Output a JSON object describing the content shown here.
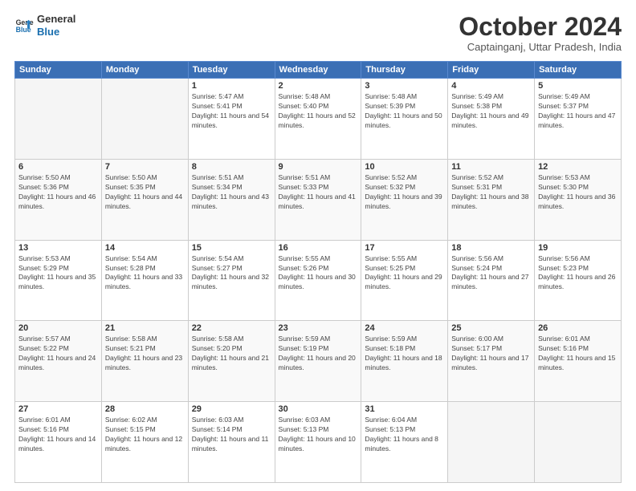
{
  "header": {
    "logo_line1": "General",
    "logo_line2": "Blue",
    "month": "October 2024",
    "location": "Captainganj, Uttar Pradesh, India"
  },
  "weekdays": [
    "Sunday",
    "Monday",
    "Tuesday",
    "Wednesday",
    "Thursday",
    "Friday",
    "Saturday"
  ],
  "weeks": [
    [
      {
        "day": "",
        "info": ""
      },
      {
        "day": "",
        "info": ""
      },
      {
        "day": "1",
        "info": "Sunrise: 5:47 AM\nSunset: 5:41 PM\nDaylight: 11 hours and 54 minutes."
      },
      {
        "day": "2",
        "info": "Sunrise: 5:48 AM\nSunset: 5:40 PM\nDaylight: 11 hours and 52 minutes."
      },
      {
        "day": "3",
        "info": "Sunrise: 5:48 AM\nSunset: 5:39 PM\nDaylight: 11 hours and 50 minutes."
      },
      {
        "day": "4",
        "info": "Sunrise: 5:49 AM\nSunset: 5:38 PM\nDaylight: 11 hours and 49 minutes."
      },
      {
        "day": "5",
        "info": "Sunrise: 5:49 AM\nSunset: 5:37 PM\nDaylight: 11 hours and 47 minutes."
      }
    ],
    [
      {
        "day": "6",
        "info": "Sunrise: 5:50 AM\nSunset: 5:36 PM\nDaylight: 11 hours and 46 minutes."
      },
      {
        "day": "7",
        "info": "Sunrise: 5:50 AM\nSunset: 5:35 PM\nDaylight: 11 hours and 44 minutes."
      },
      {
        "day": "8",
        "info": "Sunrise: 5:51 AM\nSunset: 5:34 PM\nDaylight: 11 hours and 43 minutes."
      },
      {
        "day": "9",
        "info": "Sunrise: 5:51 AM\nSunset: 5:33 PM\nDaylight: 11 hours and 41 minutes."
      },
      {
        "day": "10",
        "info": "Sunrise: 5:52 AM\nSunset: 5:32 PM\nDaylight: 11 hours and 39 minutes."
      },
      {
        "day": "11",
        "info": "Sunrise: 5:52 AM\nSunset: 5:31 PM\nDaylight: 11 hours and 38 minutes."
      },
      {
        "day": "12",
        "info": "Sunrise: 5:53 AM\nSunset: 5:30 PM\nDaylight: 11 hours and 36 minutes."
      }
    ],
    [
      {
        "day": "13",
        "info": "Sunrise: 5:53 AM\nSunset: 5:29 PM\nDaylight: 11 hours and 35 minutes."
      },
      {
        "day": "14",
        "info": "Sunrise: 5:54 AM\nSunset: 5:28 PM\nDaylight: 11 hours and 33 minutes."
      },
      {
        "day": "15",
        "info": "Sunrise: 5:54 AM\nSunset: 5:27 PM\nDaylight: 11 hours and 32 minutes."
      },
      {
        "day": "16",
        "info": "Sunrise: 5:55 AM\nSunset: 5:26 PM\nDaylight: 11 hours and 30 minutes."
      },
      {
        "day": "17",
        "info": "Sunrise: 5:55 AM\nSunset: 5:25 PM\nDaylight: 11 hours and 29 minutes."
      },
      {
        "day": "18",
        "info": "Sunrise: 5:56 AM\nSunset: 5:24 PM\nDaylight: 11 hours and 27 minutes."
      },
      {
        "day": "19",
        "info": "Sunrise: 5:56 AM\nSunset: 5:23 PM\nDaylight: 11 hours and 26 minutes."
      }
    ],
    [
      {
        "day": "20",
        "info": "Sunrise: 5:57 AM\nSunset: 5:22 PM\nDaylight: 11 hours and 24 minutes."
      },
      {
        "day": "21",
        "info": "Sunrise: 5:58 AM\nSunset: 5:21 PM\nDaylight: 11 hours and 23 minutes."
      },
      {
        "day": "22",
        "info": "Sunrise: 5:58 AM\nSunset: 5:20 PM\nDaylight: 11 hours and 21 minutes."
      },
      {
        "day": "23",
        "info": "Sunrise: 5:59 AM\nSunset: 5:19 PM\nDaylight: 11 hours and 20 minutes."
      },
      {
        "day": "24",
        "info": "Sunrise: 5:59 AM\nSunset: 5:18 PM\nDaylight: 11 hours and 18 minutes."
      },
      {
        "day": "25",
        "info": "Sunrise: 6:00 AM\nSunset: 5:17 PM\nDaylight: 11 hours and 17 minutes."
      },
      {
        "day": "26",
        "info": "Sunrise: 6:01 AM\nSunset: 5:16 PM\nDaylight: 11 hours and 15 minutes."
      }
    ],
    [
      {
        "day": "27",
        "info": "Sunrise: 6:01 AM\nSunset: 5:16 PM\nDaylight: 11 hours and 14 minutes."
      },
      {
        "day": "28",
        "info": "Sunrise: 6:02 AM\nSunset: 5:15 PM\nDaylight: 11 hours and 12 minutes."
      },
      {
        "day": "29",
        "info": "Sunrise: 6:03 AM\nSunset: 5:14 PM\nDaylight: 11 hours and 11 minutes."
      },
      {
        "day": "30",
        "info": "Sunrise: 6:03 AM\nSunset: 5:13 PM\nDaylight: 11 hours and 10 minutes."
      },
      {
        "day": "31",
        "info": "Sunrise: 6:04 AM\nSunset: 5:13 PM\nDaylight: 11 hours and 8 minutes."
      },
      {
        "day": "",
        "info": ""
      },
      {
        "day": "",
        "info": ""
      }
    ]
  ]
}
